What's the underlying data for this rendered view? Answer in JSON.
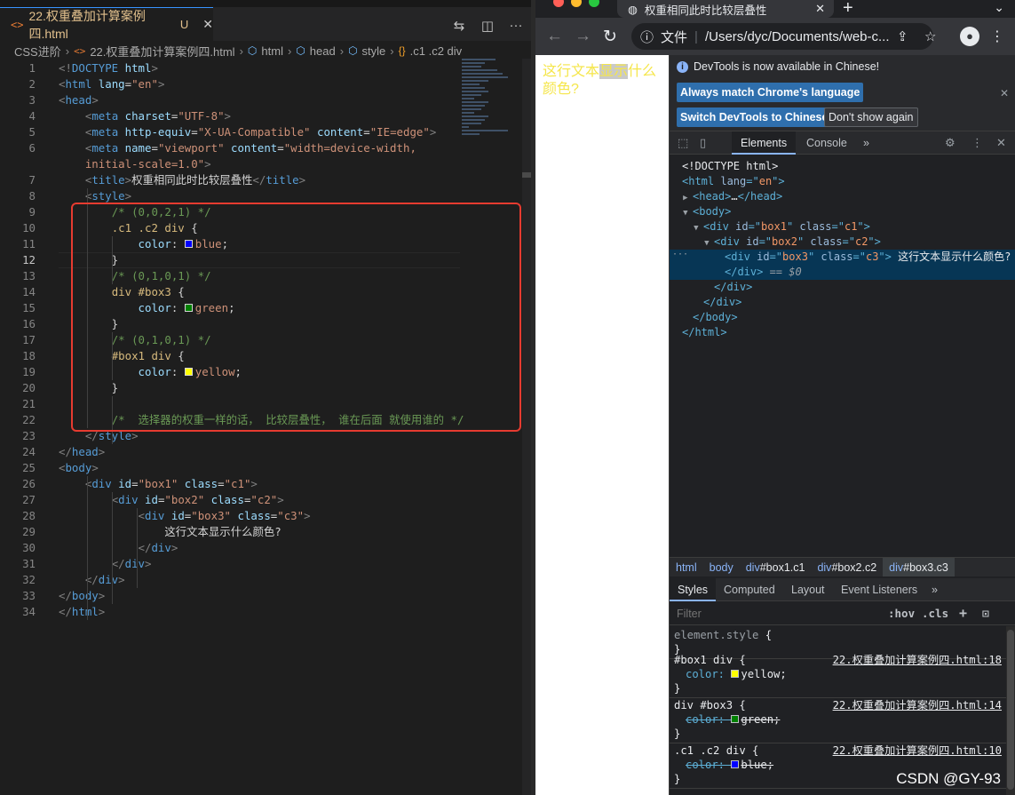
{
  "vscode": {
    "tab": {
      "icon": "<>",
      "name": "22.权重叠加计算案例四.html",
      "status": "U"
    },
    "actions": [
      "compare-icon",
      "split-editor-icon",
      "more-icon"
    ],
    "breadcrumbs": [
      "CSS进阶",
      "22.权重叠加计算案例四.html",
      "html",
      "head",
      "style",
      ".c1 .c2 div"
    ],
    "active_line": 12,
    "lines": [
      {
        "n": 1,
        "tokens": [
          [
            "p",
            "<!"
          ],
          [
            "t",
            "DOCTYPE"
          ],
          [
            "x",
            " "
          ],
          [
            "a",
            "html"
          ],
          [
            "p",
            ">"
          ]
        ]
      },
      {
        "n": 2,
        "tokens": [
          [
            "p",
            "<"
          ],
          [
            "t",
            "html"
          ],
          [
            "x",
            " "
          ],
          [
            "a",
            "lang"
          ],
          [
            "x",
            "="
          ],
          [
            "s",
            "\"en\""
          ],
          [
            "p",
            ">"
          ]
        ]
      },
      {
        "n": 3,
        "tokens": [
          [
            "p",
            "<"
          ],
          [
            "t",
            "head"
          ],
          [
            "p",
            ">"
          ]
        ]
      },
      {
        "n": 4,
        "tokens": [
          [
            "x",
            "    "
          ],
          [
            "p",
            "<"
          ],
          [
            "t",
            "meta"
          ],
          [
            "x",
            " "
          ],
          [
            "a",
            "charset"
          ],
          [
            "x",
            "="
          ],
          [
            "s",
            "\"UTF-8\""
          ],
          [
            "p",
            ">"
          ]
        ]
      },
      {
        "n": 5,
        "tokens": [
          [
            "x",
            "    "
          ],
          [
            "p",
            "<"
          ],
          [
            "t",
            "meta"
          ],
          [
            "x",
            " "
          ],
          [
            "a",
            "http-equiv"
          ],
          [
            "x",
            "="
          ],
          [
            "s",
            "\"X-UA-Compatible\""
          ],
          [
            "x",
            " "
          ],
          [
            "a",
            "content"
          ],
          [
            "x",
            "="
          ],
          [
            "s",
            "\"IE=edge\""
          ],
          [
            "p",
            ">"
          ]
        ]
      },
      {
        "n": 6,
        "tokens": [
          [
            "x",
            "    "
          ],
          [
            "p",
            "<"
          ],
          [
            "t",
            "meta"
          ],
          [
            "x",
            " "
          ],
          [
            "a",
            "name"
          ],
          [
            "x",
            "="
          ],
          [
            "s",
            "\"viewport\""
          ],
          [
            "x",
            " "
          ],
          [
            "a",
            "content"
          ],
          [
            "x",
            "="
          ],
          [
            "s",
            "\"width=device-width,"
          ]
        ]
      },
      {
        "n": "",
        "tokens": [
          [
            "x",
            "    "
          ],
          [
            "s",
            "initial-scale=1.0\""
          ],
          [
            "p",
            ">"
          ]
        ]
      },
      {
        "n": 7,
        "tokens": [
          [
            "x",
            "    "
          ],
          [
            "p",
            "<"
          ],
          [
            "t",
            "title"
          ],
          [
            "p",
            ">"
          ],
          [
            "x",
            "权重相同此时比较层叠性"
          ],
          [
            "p",
            "</"
          ],
          [
            "t",
            "title"
          ],
          [
            "p",
            ">"
          ]
        ]
      },
      {
        "n": 8,
        "tokens": [
          [
            "x",
            "    "
          ],
          [
            "p",
            "<"
          ],
          [
            "t",
            "style"
          ],
          [
            "p",
            ">"
          ]
        ]
      },
      {
        "n": 9,
        "tokens": [
          [
            "x",
            "        "
          ],
          [
            "c",
            "/* (0,0,2,1) */"
          ]
        ]
      },
      {
        "n": 10,
        "tokens": [
          [
            "x",
            "        "
          ],
          [
            "e",
            ".c1 .c2 div"
          ],
          [
            "x",
            " {"
          ]
        ]
      },
      {
        "n": 11,
        "tokens": [
          [
            "x",
            "            "
          ],
          [
            "r",
            "color"
          ],
          [
            "x",
            ": "
          ],
          [
            "w",
            "blue"
          ],
          [
            "v",
            "blue"
          ],
          [
            "x",
            ";"
          ]
        ]
      },
      {
        "n": 12,
        "tokens": [
          [
            "x",
            "        }"
          ]
        ]
      },
      {
        "n": 13,
        "tokens": [
          [
            "x",
            "        "
          ],
          [
            "c",
            "/* (0,1,0,1) */"
          ]
        ]
      },
      {
        "n": 14,
        "tokens": [
          [
            "x",
            "        "
          ],
          [
            "e",
            "div #box3"
          ],
          [
            "x",
            " {"
          ]
        ]
      },
      {
        "n": 15,
        "tokens": [
          [
            "x",
            "            "
          ],
          [
            "r",
            "color"
          ],
          [
            "x",
            ": "
          ],
          [
            "w",
            "green"
          ],
          [
            "v",
            "green"
          ],
          [
            "x",
            ";"
          ]
        ]
      },
      {
        "n": 16,
        "tokens": [
          [
            "x",
            "        }"
          ]
        ]
      },
      {
        "n": 17,
        "tokens": [
          [
            "x",
            "        "
          ],
          [
            "c",
            "/* (0,1,0,1) */"
          ]
        ]
      },
      {
        "n": 18,
        "tokens": [
          [
            "x",
            "        "
          ],
          [
            "e",
            "#box1 div"
          ],
          [
            "x",
            " {"
          ]
        ]
      },
      {
        "n": 19,
        "tokens": [
          [
            "x",
            "            "
          ],
          [
            "r",
            "color"
          ],
          [
            "x",
            ": "
          ],
          [
            "w",
            "yellow"
          ],
          [
            "v",
            "yellow"
          ],
          [
            "x",
            ";"
          ]
        ]
      },
      {
        "n": 20,
        "tokens": [
          [
            "x",
            "        }"
          ]
        ]
      },
      {
        "n": 21,
        "tokens": []
      },
      {
        "n": 22,
        "tokens": [
          [
            "x",
            "        "
          ],
          [
            "c",
            "/*  选择器的权重一样的话， 比较层叠性， 谁在后面 就使用谁的 */"
          ]
        ]
      },
      {
        "n": 23,
        "tokens": [
          [
            "x",
            "    "
          ],
          [
            "p",
            "</"
          ],
          [
            "t",
            "style"
          ],
          [
            "p",
            ">"
          ]
        ]
      },
      {
        "n": 24,
        "tokens": [
          [
            "p",
            "</"
          ],
          [
            "t",
            "head"
          ],
          [
            "p",
            ">"
          ]
        ]
      },
      {
        "n": 25,
        "tokens": [
          [
            "p",
            "<"
          ],
          [
            "t",
            "body"
          ],
          [
            "p",
            ">"
          ]
        ]
      },
      {
        "n": 26,
        "tokens": [
          [
            "x",
            "    "
          ],
          [
            "p",
            "<"
          ],
          [
            "t",
            "div"
          ],
          [
            "x",
            " "
          ],
          [
            "a",
            "id"
          ],
          [
            "x",
            "="
          ],
          [
            "s",
            "\"box1\""
          ],
          [
            "x",
            " "
          ],
          [
            "a",
            "class"
          ],
          [
            "x",
            "="
          ],
          [
            "s",
            "\"c1\""
          ],
          [
            "p",
            ">"
          ]
        ]
      },
      {
        "n": 27,
        "tokens": [
          [
            "x",
            "        "
          ],
          [
            "p",
            "<"
          ],
          [
            "t",
            "div"
          ],
          [
            "x",
            " "
          ],
          [
            "a",
            "id"
          ],
          [
            "x",
            "="
          ],
          [
            "s",
            "\"box2\""
          ],
          [
            "x",
            " "
          ],
          [
            "a",
            "class"
          ],
          [
            "x",
            "="
          ],
          [
            "s",
            "\"c2\""
          ],
          [
            "p",
            ">"
          ]
        ]
      },
      {
        "n": 28,
        "tokens": [
          [
            "x",
            "            "
          ],
          [
            "p",
            "<"
          ],
          [
            "t",
            "div"
          ],
          [
            "x",
            " "
          ],
          [
            "a",
            "id"
          ],
          [
            "x",
            "="
          ],
          [
            "s",
            "\"box3\""
          ],
          [
            "x",
            " "
          ],
          [
            "a",
            "class"
          ],
          [
            "x",
            "="
          ],
          [
            "s",
            "\"c3\""
          ],
          [
            "p",
            ">"
          ]
        ]
      },
      {
        "n": 29,
        "tokens": [
          [
            "x",
            "                这行文本显示什么颜色?"
          ]
        ]
      },
      {
        "n": 30,
        "tokens": [
          [
            "x",
            "            "
          ],
          [
            "p",
            "</"
          ],
          [
            "t",
            "div"
          ],
          [
            "p",
            ">"
          ]
        ]
      },
      {
        "n": 31,
        "tokens": [
          [
            "x",
            "        "
          ],
          [
            "p",
            "</"
          ],
          [
            "t",
            "div"
          ],
          [
            "p",
            ">"
          ]
        ]
      },
      {
        "n": 32,
        "tokens": [
          [
            "x",
            "    "
          ],
          [
            "p",
            "</"
          ],
          [
            "t",
            "div"
          ],
          [
            "p",
            ">"
          ]
        ]
      },
      {
        "n": 33,
        "tokens": [
          [
            "p",
            "</"
          ],
          [
            "t",
            "body"
          ],
          [
            "p",
            ">"
          ]
        ]
      },
      {
        "n": 34,
        "tokens": [
          [
            "p",
            "</"
          ],
          [
            "t",
            "html"
          ],
          [
            "p",
            ">"
          ]
        ]
      }
    ]
  },
  "browser": {
    "tab_title": "权重相同此时比较层叠性",
    "new_tab": "+",
    "address_label": "文件",
    "address": "/Users/dyc/Documents/web-c...",
    "page_text_a": "这行文本",
    "page_text_hl": "显示",
    "page_text_b": "什么颜色?"
  },
  "devtools": {
    "info_text": "DevTools is now available in Chinese!",
    "btn_match": "Always match Chrome's language",
    "btn_switch": "Switch DevTools to Chinese",
    "btn_dont": "Don't show again",
    "tabs": [
      "Elements",
      "Console",
      "»"
    ],
    "dom": [
      {
        "indent": 0,
        "tri": "",
        "tokens": [
          [
            "d",
            "<!DOCTYPE html>"
          ]
        ]
      },
      {
        "indent": 0,
        "tri": "",
        "tokens": [
          [
            "t",
            "<html "
          ],
          [
            "a",
            "lang"
          ],
          [
            "t",
            "=\""
          ],
          [
            "s",
            "en"
          ],
          [
            "t",
            "\">"
          ]
        ]
      },
      {
        "indent": 1,
        "tri": "▶",
        "tokens": [
          [
            "t",
            "<head>"
          ],
          [
            "x",
            "…"
          ],
          [
            "t",
            "</head>"
          ]
        ]
      },
      {
        "indent": 1,
        "tri": "▼",
        "tokens": [
          [
            "t",
            "<body>"
          ]
        ]
      },
      {
        "indent": 2,
        "tri": "▼",
        "tokens": [
          [
            "t",
            "<div "
          ],
          [
            "a",
            "id"
          ],
          [
            "t",
            "=\""
          ],
          [
            "s",
            "box1"
          ],
          [
            "t",
            "\" "
          ],
          [
            "a",
            "class"
          ],
          [
            "t",
            "=\""
          ],
          [
            "s",
            "c1"
          ],
          [
            "t",
            "\">"
          ]
        ]
      },
      {
        "indent": 3,
        "tri": "▼",
        "tokens": [
          [
            "t",
            "<div "
          ],
          [
            "a",
            "id"
          ],
          [
            "t",
            "=\""
          ],
          [
            "s",
            "box2"
          ],
          [
            "t",
            "\" "
          ],
          [
            "a",
            "class"
          ],
          [
            "t",
            "=\""
          ],
          [
            "s",
            "c2"
          ],
          [
            "t",
            "\">"
          ]
        ]
      },
      {
        "indent": 4,
        "tri": "",
        "sel": true,
        "tokens": [
          [
            "t",
            "<div "
          ],
          [
            "a",
            "id"
          ],
          [
            "t",
            "=\""
          ],
          [
            "s",
            "box3"
          ],
          [
            "t",
            "\" "
          ],
          [
            "a",
            "class"
          ],
          [
            "t",
            "=\""
          ],
          [
            "s",
            "c3"
          ],
          [
            "t",
            "\">"
          ],
          [
            "x",
            " 这行文本显示什么颜色?"
          ]
        ]
      },
      {
        "indent": 4,
        "tri": "",
        "sel": true,
        "tokens": [
          [
            "t",
            "</div>"
          ],
          [
            "e",
            " == "
          ],
          [
            "m",
            "$0"
          ]
        ]
      },
      {
        "indent": 3,
        "tri": "",
        "tokens": [
          [
            "t",
            "</div>"
          ]
        ]
      },
      {
        "indent": 2,
        "tri": "",
        "tokens": [
          [
            "t",
            "</div>"
          ]
        ]
      },
      {
        "indent": 1,
        "tri": "",
        "tokens": [
          [
            "t",
            "</body>"
          ]
        ]
      },
      {
        "indent": 0,
        "tri": "",
        "tokens": [
          [
            "t",
            "</html>"
          ]
        ]
      }
    ],
    "crumbs": [
      {
        "tag": "html",
        "rest": ""
      },
      {
        "tag": "body",
        "rest": ""
      },
      {
        "tag": "div",
        "rest": "#box1.c1"
      },
      {
        "tag": "div",
        "rest": "#box2.c2"
      },
      {
        "tag": "div",
        "rest": "#box3.c3"
      }
    ],
    "style_tabs": [
      "Styles",
      "Computed",
      "Layout",
      "Event Listeners",
      "»"
    ],
    "filter_placeholder": "Filter",
    "hov": ":hov",
    "cls": ".cls",
    "rules": [
      {
        "selector": "element.style {",
        "src": "",
        "props": [],
        "close": "}"
      },
      {
        "selector": "#box1 div {",
        "src": "22.权重叠加计算案例四.html:18",
        "props": [
          {
            "name": "color",
            "value": "yellow",
            "color": "#ffff00",
            "struck": false
          }
        ],
        "close": "}"
      },
      {
        "selector": "div #box3 {",
        "src": "22.权重叠加计算案例四.html:14",
        "props": [
          {
            "name": "color",
            "value": "green",
            "color": "#008000",
            "struck": true
          }
        ],
        "close": "}"
      },
      {
        "selector": ".c1 .c2 div {",
        "src": "22.权重叠加计算案例四.html:10",
        "props": [
          {
            "name": "color",
            "value": "blue",
            "color": "#0000ff",
            "struck": true
          }
        ],
        "close": "}"
      }
    ]
  },
  "watermark": "CSDN @GY-93",
  "colors": {
    "vscode_bg": "#1e1e1e",
    "highlight_box": "#e63b30",
    "page_text": "#f5e64a",
    "devtools_selected_row": "#073655"
  }
}
